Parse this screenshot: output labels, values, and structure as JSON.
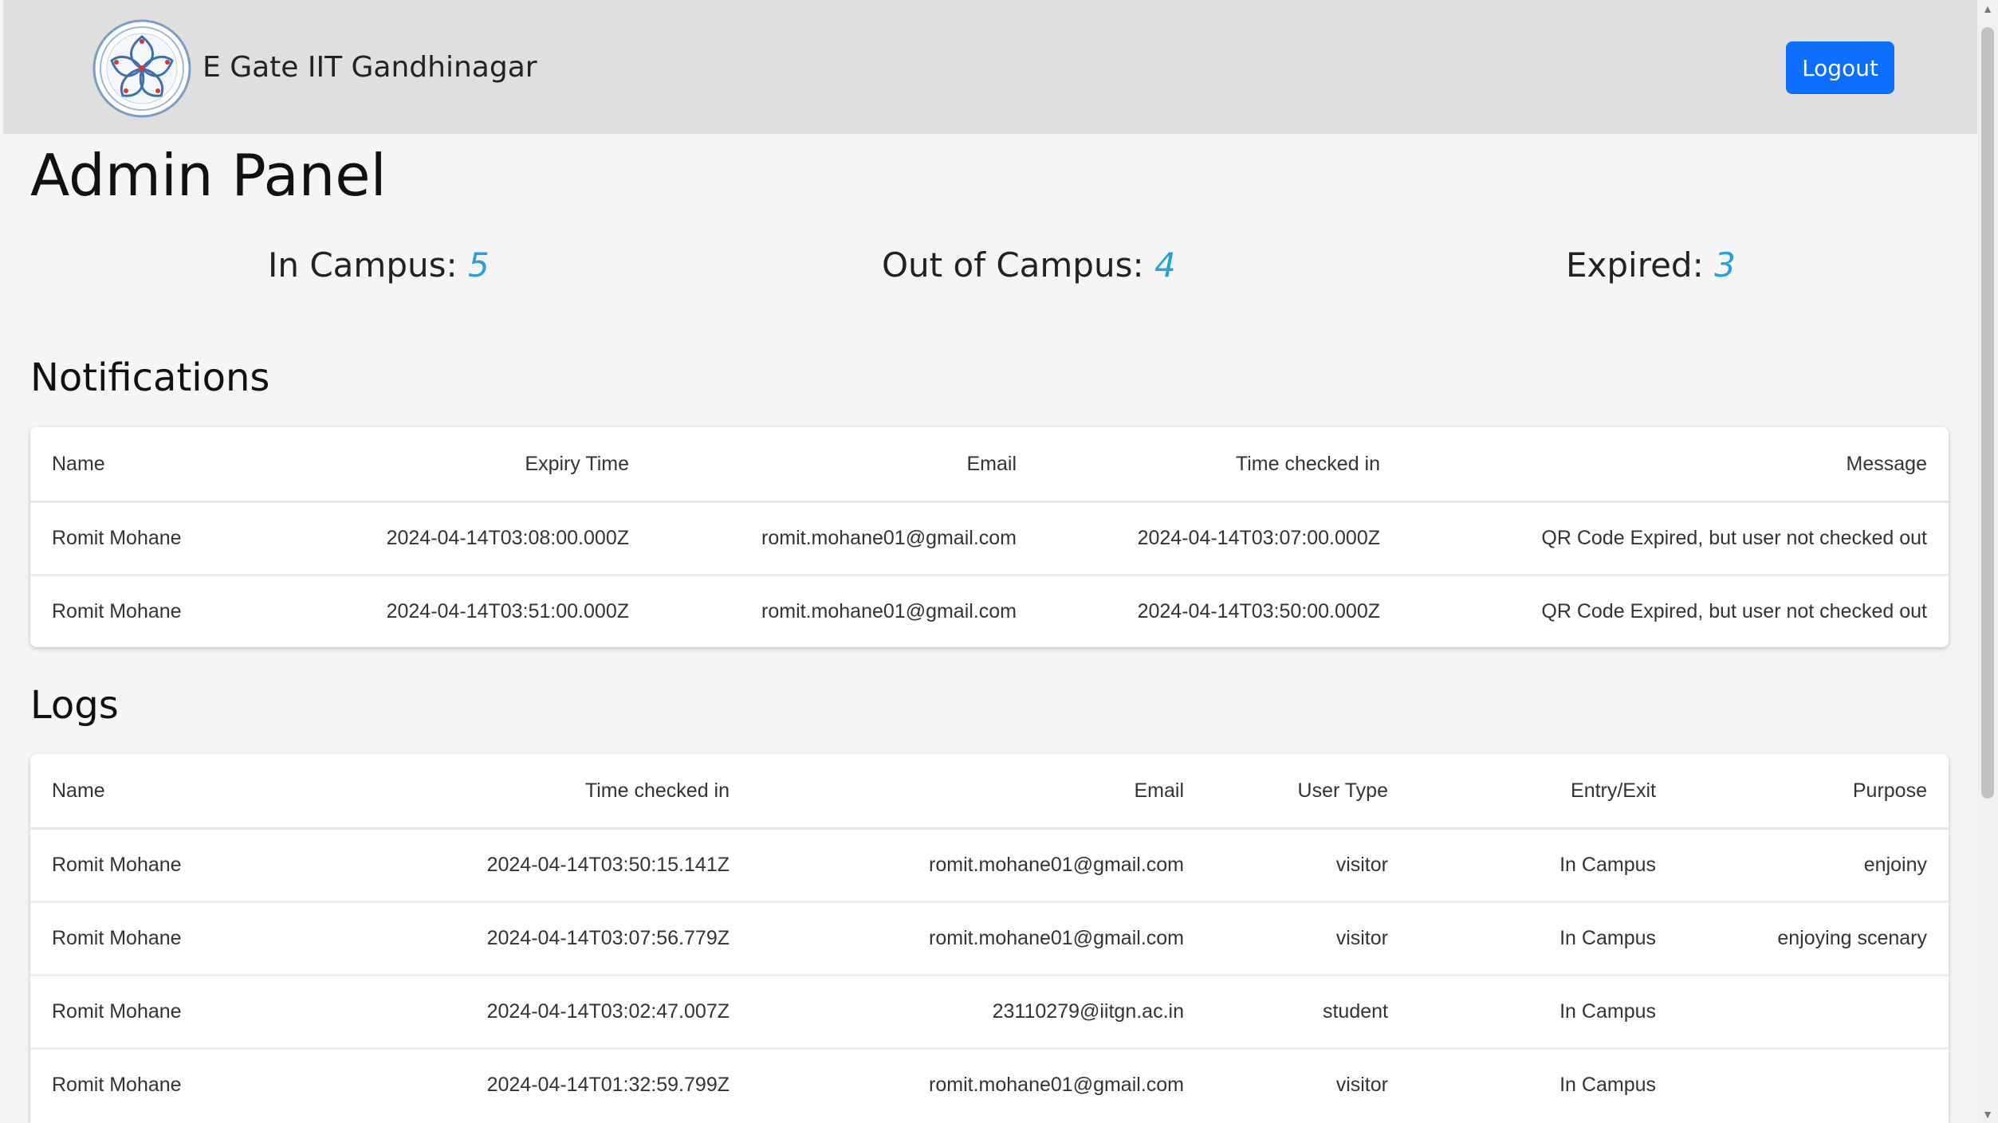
{
  "navbar": {
    "brand_title": "E Gate IIT Gandhinagar",
    "logout_label": "Logout",
    "logo_icon": "institute-emblem-icon"
  },
  "page_title": "Admin Panel",
  "stats": [
    {
      "label": "In Campus:",
      "value": "5"
    },
    {
      "label": "Out of Campus:",
      "value": "4"
    },
    {
      "label": "Expired:",
      "value": "3"
    }
  ],
  "colors": {
    "navbar_bg": "#dfdfdf",
    "primary_button": "#0d6efd",
    "stat_value": "#2b9fd8",
    "page_bg": "#f5f5f5"
  },
  "notifications": {
    "title": "Notifications",
    "columns": [
      "Name",
      "Expiry Time",
      "Email",
      "Time checked in",
      "Message"
    ],
    "rows": [
      [
        "Romit Mohane",
        "2024-04-14T03:08:00.000Z",
        "romit.mohane01@gmail.com",
        "2024-04-14T03:07:00.000Z",
        "QR Code Expired, but user not checked out"
      ],
      [
        "Romit Mohane",
        "2024-04-14T03:51:00.000Z",
        "romit.mohane01@gmail.com",
        "2024-04-14T03:50:00.000Z",
        "QR Code Expired, but user not checked out"
      ]
    ]
  },
  "logs": {
    "title": "Logs",
    "columns": [
      "Name",
      "Time checked in",
      "Email",
      "User Type",
      "Entry/Exit",
      "Purpose"
    ],
    "rows": [
      [
        "Romit Mohane",
        "2024-04-14T03:50:15.141Z",
        "romit.mohane01@gmail.com",
        "visitor",
        "In Campus",
        "enjoiny"
      ],
      [
        "Romit Mohane",
        "2024-04-14T03:07:56.779Z",
        "romit.mohane01@gmail.com",
        "visitor",
        "In Campus",
        "enjoying scenary"
      ],
      [
        "Romit Mohane",
        "2024-04-14T03:02:47.007Z",
        "23110279@iitgn.ac.in",
        "student",
        "In Campus",
        ""
      ],
      [
        "Romit Mohane",
        "2024-04-14T01:32:59.799Z",
        "romit.mohane01@gmail.com",
        "visitor",
        "In Campus",
        ""
      ]
    ]
  }
}
